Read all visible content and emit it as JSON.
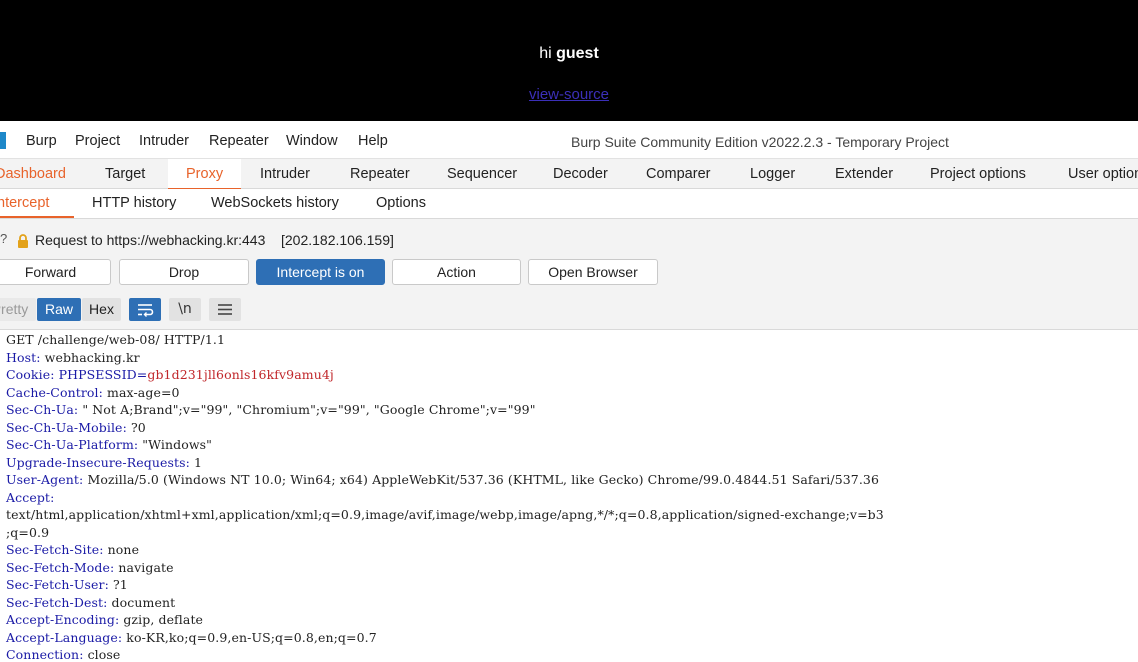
{
  "webpage": {
    "greeting_prefix": "hi",
    "greeting_name": "guest",
    "view_source": "view-source"
  },
  "menubar": {
    "items": [
      "Burp",
      "Project",
      "Intruder",
      "Repeater",
      "Window",
      "Help"
    ],
    "title": "Burp Suite Community Edition v2022.2.3 - Temporary Project"
  },
  "main_tabs": [
    "Dashboard",
    "Target",
    "Proxy",
    "Intruder",
    "Repeater",
    "Sequencer",
    "Decoder",
    "Comparer",
    "Logger",
    "Extender",
    "Project options",
    "User options"
  ],
  "proxy_tabs": [
    "Intercept",
    "HTTP history",
    "WebSockets history",
    "Options"
  ],
  "intercept": {
    "request_to": "Request to https://webhacking.kr:443",
    "ip": "[202.182.106.159]",
    "buttons": {
      "forward": "Forward",
      "drop": "Drop",
      "intercept_toggle": "Intercept is on",
      "action": "Action",
      "open_browser": "Open Browser"
    },
    "view_modes": {
      "pretty": "Pretty",
      "raw": "Raw",
      "hex": "Hex",
      "newline": "\\n"
    }
  },
  "request": {
    "request_line": "GET /challenge/web-08/ HTTP/1.1",
    "headers": [
      {
        "key": "Host",
        "value": "webhacking.kr"
      },
      {
        "key": "Cookie",
        "cookie_name": "PHPSESSID",
        "cookie_value": "gb1d231jll6onls16kfv9amu4j"
      },
      {
        "key": "Cache-Control",
        "value": "max-age=0"
      },
      {
        "key": "Sec-Ch-Ua",
        "value": "\" Not A;Brand\";v=\"99\", \"Chromium\";v=\"99\", \"Google Chrome\";v=\"99\""
      },
      {
        "key": "Sec-Ch-Ua-Mobile",
        "value": "?0"
      },
      {
        "key": "Sec-Ch-Ua-Platform",
        "value": "\"Windows\""
      },
      {
        "key": "Upgrade-Insecure-Requests",
        "value": "1"
      },
      {
        "key": "User-Agent",
        "value": "Mozilla/5.0 (Windows NT 10.0; Win64; x64) AppleWebKit/537.36 (KHTML, like Gecko) Chrome/99.0.4844.51 Safari/537.36"
      },
      {
        "key": "Accept",
        "value": ""
      },
      {
        "key": "",
        "value": "text/html,application/xhtml+xml,application/xml;q=0.9,image/avif,image/webp,image/apng,*/*;q=0.8,application/signed-exchange;v=b3"
      },
      {
        "key": "",
        "value": ";q=0.9"
      },
      {
        "key": "Sec-Fetch-Site",
        "value": "none"
      },
      {
        "key": "Sec-Fetch-Mode",
        "value": "navigate"
      },
      {
        "key": "Sec-Fetch-User",
        "value": "?1"
      },
      {
        "key": "Sec-Fetch-Dest",
        "value": "document"
      },
      {
        "key": "Accept-Encoding",
        "value": "gzip, deflate"
      },
      {
        "key": "Accept-Language",
        "value": "ko-KR,ko;q=0.9,en-US;q=0.8,en;q=0.7"
      },
      {
        "key": "Connection",
        "value": "close"
      }
    ]
  },
  "colors": {
    "accent_orange": "#e8632b",
    "primary_blue": "#2e6fb5",
    "header_key_blue": "#1a1aa6",
    "cookie_value_red": "#c0262a"
  }
}
